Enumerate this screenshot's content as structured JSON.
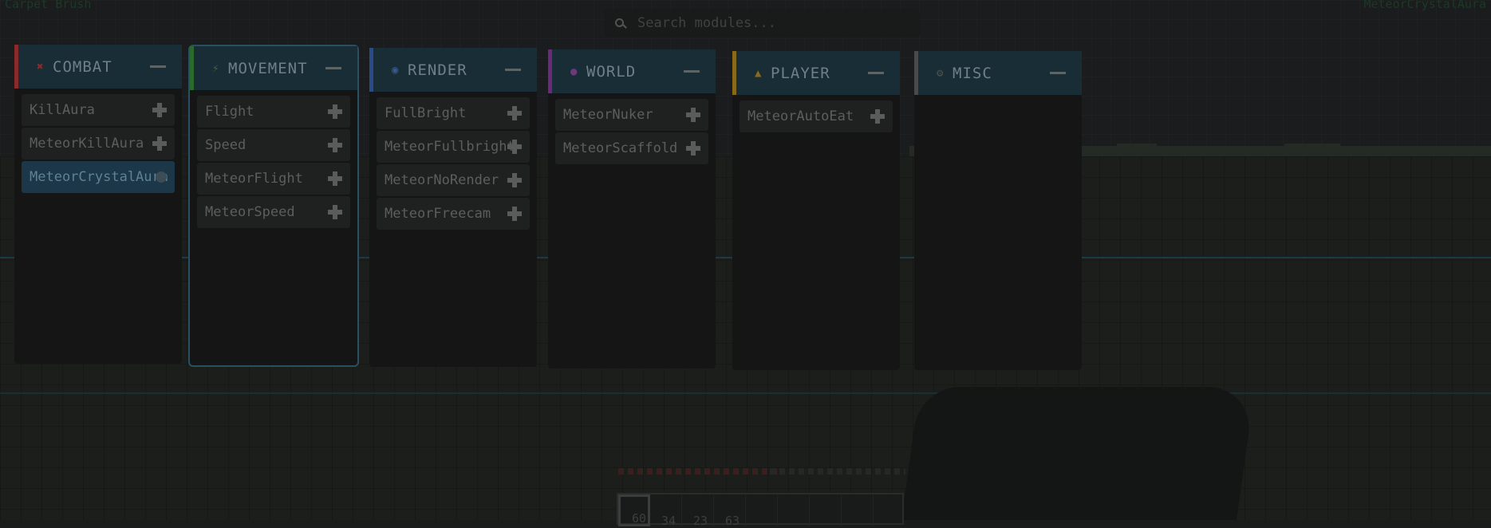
{
  "hud": {
    "left_text": "Carpet Brush",
    "right_text": "MeteorCrystalAura"
  },
  "search": {
    "placeholder": "Search modules..."
  },
  "panels": [
    {
      "title": "COMBAT",
      "icon": "crossed-swords-icon",
      "accent": "#8a2a2a",
      "modules": [
        {
          "label": "KillAura",
          "active": false
        },
        {
          "label": "MeteorKillAura",
          "active": false
        },
        {
          "label": "MeteorCrystalAura",
          "active": true
        }
      ]
    },
    {
      "title": "MOVEMENT",
      "icon": "lightning-icon",
      "accent": "#2a6a2a",
      "selected": true,
      "modules": [
        {
          "label": "Flight",
          "active": false
        },
        {
          "label": "Speed",
          "active": false
        },
        {
          "label": "MeteorFlight",
          "active": false
        },
        {
          "label": "MeteorSpeed",
          "active": false
        }
      ]
    },
    {
      "title": "RENDER",
      "icon": "eye-icon",
      "accent": "#2a4a8a",
      "modules": [
        {
          "label": "FullBright",
          "active": false
        },
        {
          "label": "MeteorFullbright",
          "active": false
        },
        {
          "label": "MeteorNoRender",
          "active": false
        },
        {
          "label": "MeteorFreecam",
          "active": false
        }
      ]
    },
    {
      "title": "WORLD",
      "icon": "globe-icon",
      "accent": "#6a2a7a",
      "modules": [
        {
          "label": "MeteorNuker",
          "active": false
        },
        {
          "label": "MeteorScaffold",
          "active": false
        }
      ]
    },
    {
      "title": "PLAYER",
      "icon": "person-icon",
      "accent": "#8a6a1a",
      "modules": [
        {
          "label": "MeteorAutoEat",
          "active": false
        }
      ]
    },
    {
      "title": "MISC",
      "icon": "gear-icon",
      "accent": "#4a4a4a",
      "modules": []
    }
  ],
  "hotbar": {
    "counts": [
      "60",
      "34",
      "23",
      "63"
    ]
  },
  "colors": {
    "panel_header": "#182d36",
    "active_module": "#1c3748"
  }
}
